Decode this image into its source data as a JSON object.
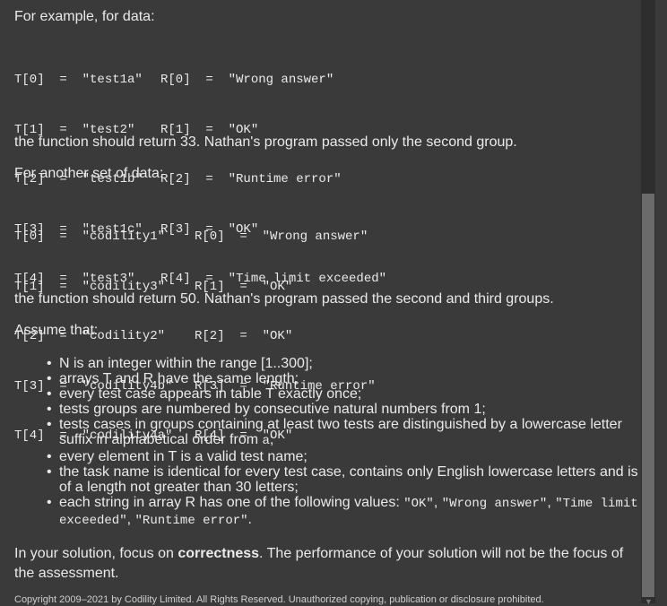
{
  "intro1": "For example, for data:",
  "example1": {
    "rows": [
      {
        "t": "T[0]  =  \"test1a\"",
        "r": "R[0]  =  \"Wrong answer\""
      },
      {
        "t": "T[1]  =  \"test2\"",
        "r": "R[1]  =  \"OK\""
      },
      {
        "t": "T[2]  =  \"test1b\"",
        "r": "R[2]  =  \"Runtime error\""
      },
      {
        "t": "T[3]  =  \"test1c\"",
        "r": "R[3]  =  \"OK\""
      },
      {
        "t": "T[4]  =  \"test3\"",
        "r": "R[4]  =  \"Time limit exceeded\""
      }
    ]
  },
  "result1": "the function should return 33. Nathan's program passed only the second group.",
  "intro2": "For another set of data:",
  "example2": {
    "rows": [
      {
        "t": "T[0]  =  \"codility1\"",
        "r": "R[0]  =  \"Wrong answer\""
      },
      {
        "t": "T[1]  =  \"codility3\"",
        "r": "R[1]  =  \"OK\""
      },
      {
        "t": "T[2]  =  \"codility2\"",
        "r": "R[2]  =  \"OK\""
      },
      {
        "t": "T[3]  =  \"codility4b\"",
        "r": "R[3]  =  \"Runtime error\""
      },
      {
        "t": "T[4]  =  \"codility4a\"",
        "r": "R[4]  =  \"OK\""
      }
    ]
  },
  "result2": "the function should return 50. Nathan's program passed the second and third groups.",
  "assume": "Assume that:",
  "bullets": {
    "b1": "N is an integer within the range [1..300];",
    "b2": "arrays T and R have the same length;",
    "b3": "every test case appears in table T exactly once;",
    "b4": "tests groups are numbered by consecutive natural numbers from 1;",
    "b5a": "tests cases in groups containing at least two tests are distinguished by a lowercase letter suffix in alphabetical order from ",
    "b5code": "a",
    "b5b": ";",
    "b6": "every element in T is a valid test name;",
    "b7": "the task name is identical for every test case, contains only English lowercase letters and is of a length not greater than 30 letters;",
    "b8a": "each string in array R has one of the following values: ",
    "b8c1": "\"OK\"",
    "b8s1": ", ",
    "b8c2": "\"Wrong answer\"",
    "b8s2": ", ",
    "b8c3": "\"Time limit exceeded\"",
    "b8s3": ", ",
    "b8c4": "\"Runtime error\"",
    "b8b": "."
  },
  "focus_a": "In your solution, focus on ",
  "focus_strong": "correctness",
  "focus_b": ". The performance of your solution will not be the focus of the assessment.",
  "copyright": "Copyright 2009–2021 by Codility Limited. All Rights Reserved. Unauthorized copying, publication or disclosure prohibited."
}
